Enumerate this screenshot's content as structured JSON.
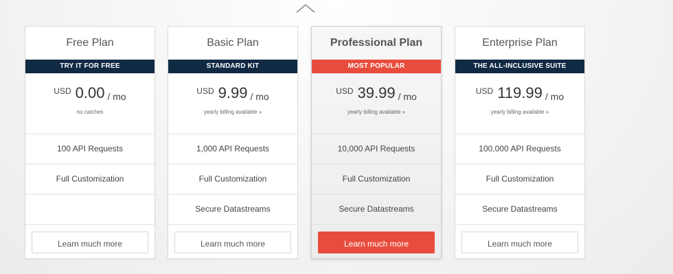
{
  "colors": {
    "ribbon_dark": "#102a44",
    "accent_red": "#e84c3d"
  },
  "navigation": {
    "scroll_up_icon": "chevron-up-icon"
  },
  "plans": [
    {
      "name": "Free Plan",
      "ribbon": "TRY IT FOR FREE",
      "currency": "USD",
      "amount": "0.00",
      "period": "/ mo",
      "note": "no catches",
      "features": [
        "100 API Requests",
        "Full Customization",
        ""
      ],
      "cta": "Learn much more",
      "featured": false
    },
    {
      "name": "Basic Plan",
      "ribbon": "STANDARD KIT",
      "currency": "USD",
      "amount": "9.99",
      "period": "/ mo",
      "note": "yearly billing available »",
      "features": [
        "1,000 API Requests",
        "Full Customization",
        "Secure Datastreams"
      ],
      "cta": "Learn much more",
      "featured": false
    },
    {
      "name": "Professional Plan",
      "ribbon": "MOST POPULAR",
      "currency": "USD",
      "amount": "39.99",
      "period": "/ mo",
      "note": "yearly billing available »",
      "features": [
        "10,000 API Requests",
        "Full Customization",
        "Secure Datastreams"
      ],
      "cta": "Learn much more",
      "featured": true
    },
    {
      "name": "Enterprise Plan",
      "ribbon": "THE ALL-INCLUSIVE SUITE",
      "currency": "USD",
      "amount": "119.99",
      "period": "/ mo",
      "note": "yearly billing available »",
      "features": [
        "100,000 API Requests",
        "Full Customization",
        "Secure Datastreams"
      ],
      "cta": "Learn much more",
      "featured": false
    }
  ]
}
